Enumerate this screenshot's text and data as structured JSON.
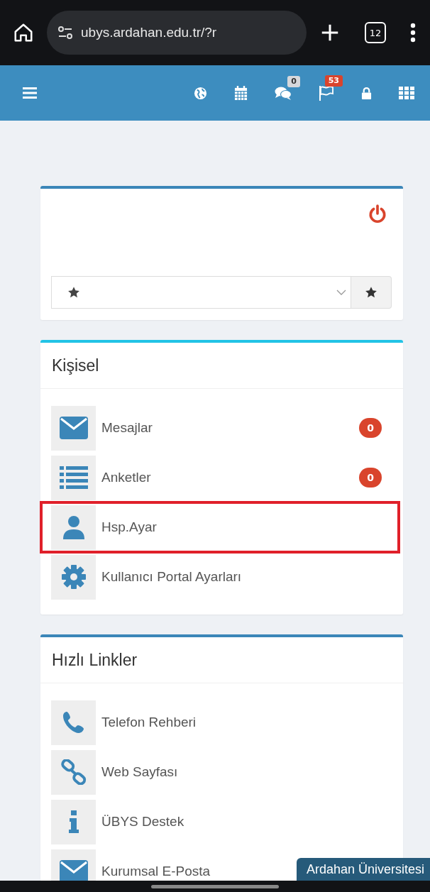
{
  "browser": {
    "url": "ubys.ardahan.edu.tr/?r",
    "tab_count": "12"
  },
  "navbar": {
    "icons": [
      {
        "kind": "globe"
      },
      {
        "kind": "calendar"
      },
      {
        "kind": "chat",
        "badge": {
          "text": "0",
          "color": "#d6d8dc"
        }
      },
      {
        "kind": "flag",
        "badge": {
          "text": "53",
          "color": "#d9442c"
        }
      },
      {
        "kind": "lock"
      },
      {
        "kind": "grid"
      }
    ]
  },
  "sections": [
    {
      "title": "Kişisel",
      "color": "#22c3e6",
      "items": [
        {
          "kind": "mail",
          "label": "Mesajlar",
          "badge": "0",
          "highlighted": false
        },
        {
          "kind": "list",
          "label": "Anketler",
          "badge": "0",
          "highlighted": false
        },
        {
          "kind": "user",
          "label": "Hsp.Ayar",
          "highlighted": true
        },
        {
          "kind": "gear",
          "label": "Kullanıcı Portal Ayarları",
          "highlighted": false
        }
      ]
    },
    {
      "title": "Hızlı Linkler",
      "color": "#3b86b8",
      "items": [
        {
          "kind": "phone",
          "label": "Telefon Rehberi",
          "highlighted": false
        },
        {
          "kind": "link",
          "label": "Web Sayfası",
          "highlighted": false
        },
        {
          "kind": "info",
          "label": "ÜBYS Destek",
          "highlighted": false
        },
        {
          "kind": "mail",
          "label": "Kurumsal E-Posta",
          "highlighted": false
        }
      ]
    }
  ],
  "footer_tab": "Ardahan Üniversitesi"
}
